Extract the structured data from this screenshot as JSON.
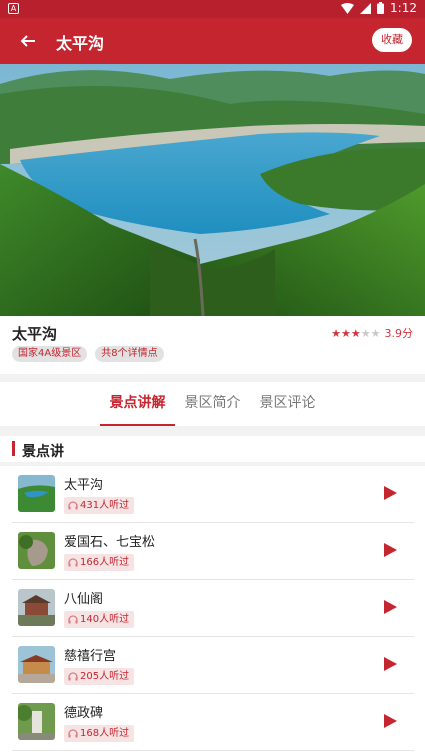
{
  "status_bar": {
    "app_badge": "A",
    "time": "1:12"
  },
  "app_bar": {
    "title": "太平沟",
    "favorite_label": "收藏"
  },
  "scenic": {
    "name": "太平沟",
    "rating_text": "3.9分",
    "rating_stars": 3,
    "tags": [
      "国家4A级景区",
      "共8个详情点"
    ]
  },
  "tabs": [
    {
      "label": "景点讲解",
      "active": true
    },
    {
      "label": "景区简介",
      "active": false
    },
    {
      "label": "景区评论",
      "active": false
    }
  ],
  "section_title": "景点讲",
  "spots": [
    {
      "name": "太平沟",
      "listens": "431人听过"
    },
    {
      "name": "爱国石、七宝松",
      "listens": "166人听过"
    },
    {
      "name": "八仙阁",
      "listens": "140人听过"
    },
    {
      "name": "慈禧行宫",
      "listens": "205人听过"
    },
    {
      "name": "德政碑",
      "listens": "168人听过"
    }
  ],
  "colors": {
    "brand_red": "#c5252f"
  }
}
